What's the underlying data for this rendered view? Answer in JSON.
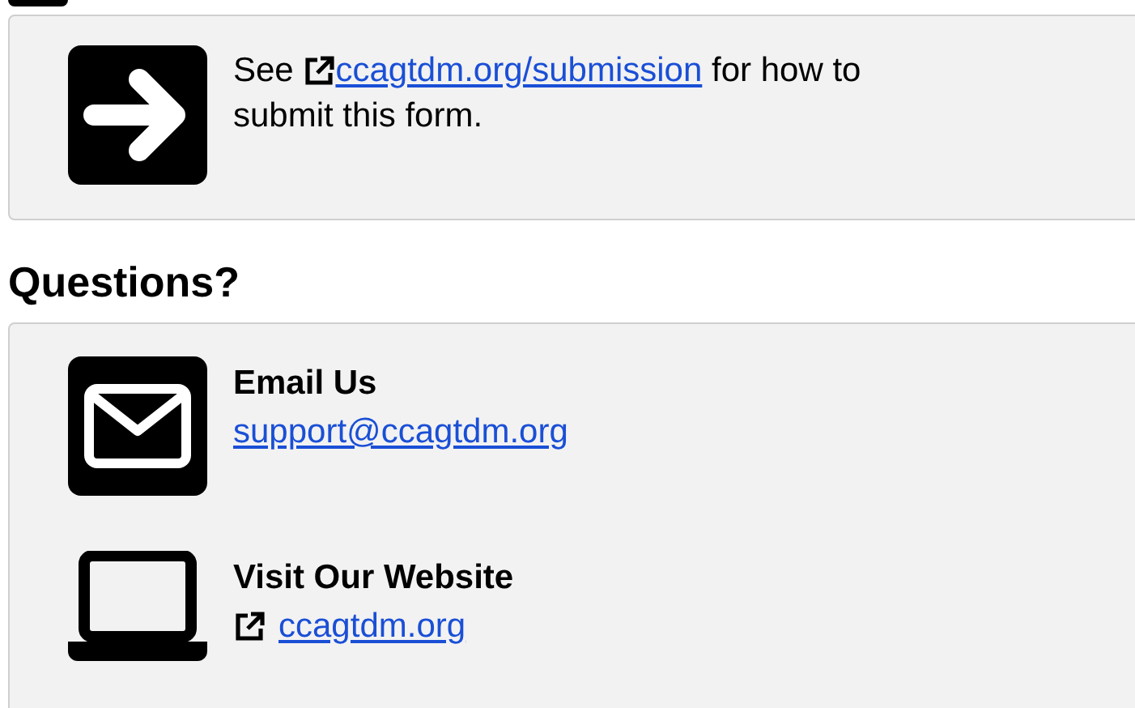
{
  "notice": {
    "text_before": "See",
    "link": "ccagtdm.org/submission",
    "text_after": "for how to submit this form."
  },
  "questions": {
    "heading": "Questions?",
    "items": [
      {
        "kind": "email",
        "title": "Email Us",
        "link": "support@ccagtdm.org",
        "external": false
      },
      {
        "kind": "website",
        "title": "Visit Our Website",
        "link": "ccagtdm.org",
        "external": true
      }
    ]
  }
}
